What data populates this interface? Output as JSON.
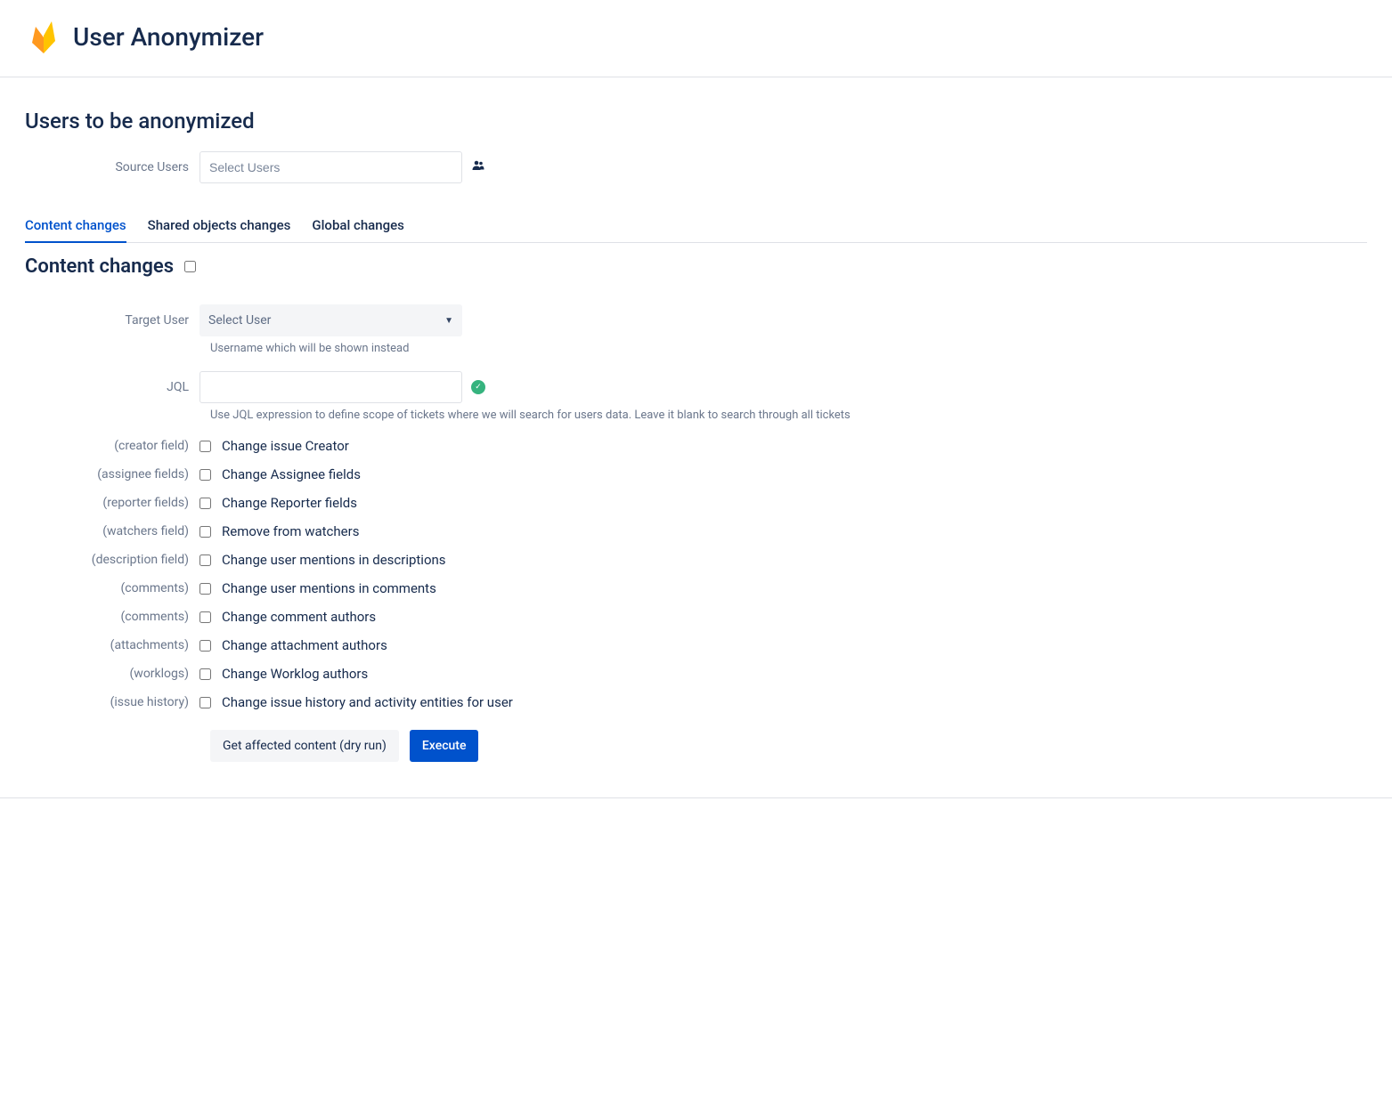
{
  "header": {
    "title": "User Anonymizer"
  },
  "section": {
    "title": "Users to be anonymized",
    "source_users": {
      "label": "Source Users",
      "placeholder": "Select Users"
    }
  },
  "tabs": [
    {
      "label": "Content changes",
      "active": true
    },
    {
      "label": "Shared objects changes",
      "active": false
    },
    {
      "label": "Global changes",
      "active": false
    }
  ],
  "content": {
    "title": "Content changes",
    "target_user": {
      "label": "Target User",
      "placeholder": "Select User",
      "helper": "Username which will be shown instead"
    },
    "jql": {
      "label": "JQL",
      "helper": "Use JQL expression to define scope of tickets where we will search for users data. Leave it blank to search through all tickets"
    },
    "options": [
      {
        "field": "(creator field)",
        "label": "Change issue Creator"
      },
      {
        "field": "(assignee fields)",
        "label": "Change Assignee fields"
      },
      {
        "field": "(reporter fields)",
        "label": "Change Reporter fields"
      },
      {
        "field": "(watchers field)",
        "label": "Remove from watchers"
      },
      {
        "field": "(description field)",
        "label": "Change user mentions in descriptions"
      },
      {
        "field": "(comments)",
        "label": "Change user mentions in comments"
      },
      {
        "field": "(comments)",
        "label": "Change comment authors"
      },
      {
        "field": "(attachments)",
        "label": "Change attachment authors"
      },
      {
        "field": "(worklogs)",
        "label": "Change Worklog authors"
      },
      {
        "field": "(issue history)",
        "label": "Change issue history and activity entities for user"
      }
    ],
    "buttons": {
      "dry_run": "Get affected content (dry run)",
      "execute": "Execute"
    }
  }
}
